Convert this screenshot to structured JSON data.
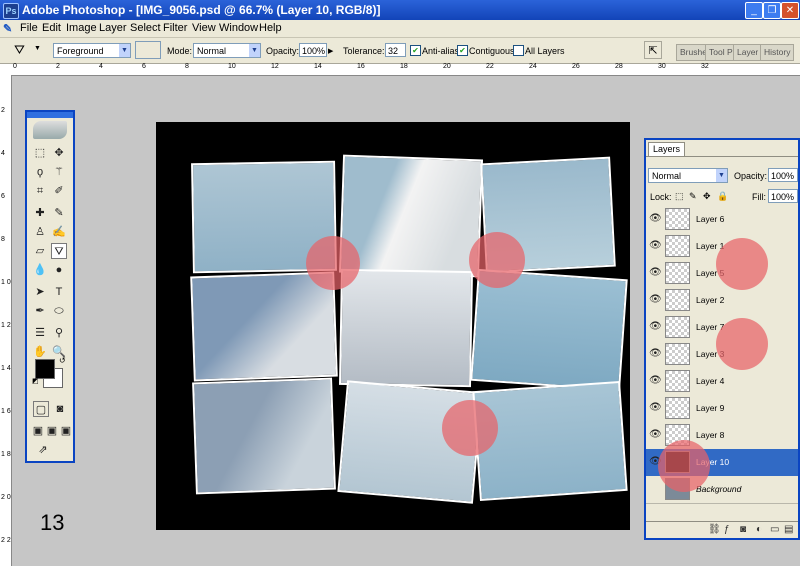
{
  "window": {
    "title": "Adobe Photoshop - [IMG_9056.psd @ 66.7% (Layer 10, RGB/8)]",
    "minimize": "_",
    "restore": "❐",
    "close": "✕"
  },
  "menu": [
    "File",
    "Edit",
    "Image",
    "Layer",
    "Select",
    "Filter",
    "View",
    "Window",
    "Help"
  ],
  "options": {
    "fill_source": "Foreground",
    "mode_label": "Mode:",
    "mode_value": "Normal",
    "opacity_label": "Opacity:",
    "opacity_value": "100%",
    "tolerance_label": "Tolerance:",
    "tolerance_value": "32",
    "anti_alias_label": "Anti-alias",
    "contiguous_label": "Contiguous",
    "all_layers_label": "All Layers",
    "anti_alias_checked": true,
    "contiguous_checked": true,
    "all_layers_checked": false
  },
  "palette_well": [
    "Brushe",
    "Tool P",
    "Layer",
    "History"
  ],
  "ruler_numbers": [
    "0",
    "2",
    "4",
    "6",
    "8",
    "10",
    "12",
    "14",
    "16",
    "18",
    "20",
    "22",
    "24",
    "26",
    "28",
    "30",
    "32"
  ],
  "vruler_numbers": [
    "2",
    "4",
    "6",
    "8",
    "1 0",
    "1 2",
    "1 4",
    "1 6",
    "1 8",
    "2 0",
    "2 2"
  ],
  "step_number": "13",
  "tools": [
    "marquee-icon",
    "move-icon",
    "lasso-icon",
    "magic-wand-icon",
    "crop-icon",
    "slice-icon",
    "healing-brush-icon",
    "brush-icon",
    "clone-stamp-icon",
    "history-brush-icon",
    "eraser-icon",
    "paint-bucket-icon",
    "blur-icon",
    "dodge-icon",
    "path-selection-icon",
    "type-icon",
    "pen-icon",
    "shape-icon",
    "notes-icon",
    "eyedropper-icon",
    "hand-icon",
    "zoom-icon"
  ],
  "layers_panel": {
    "tab": "Layers",
    "blend_mode": "Normal",
    "opacity_label": "Opacity:",
    "opacity_value": "100%",
    "lock_label": "Lock:",
    "fill_label": "Fill:",
    "fill_value": "100%",
    "layers": [
      {
        "name": "Layer 6",
        "active": false
      },
      {
        "name": "Layer 1",
        "active": false
      },
      {
        "name": "Layer 5",
        "active": false
      },
      {
        "name": "Layer 2",
        "active": false
      },
      {
        "name": "Layer 7",
        "active": false
      },
      {
        "name": "Layer 3",
        "active": false
      },
      {
        "name": "Layer 4",
        "active": false
      },
      {
        "name": "Layer 9",
        "active": false
      },
      {
        "name": "Layer 8",
        "active": false
      },
      {
        "name": "Layer 10",
        "active": true
      },
      {
        "name": "Background",
        "active": false
      }
    ]
  },
  "colors": {
    "titlebar": "#1548c4",
    "highlight_circle": "#e86268",
    "active_layer": "#316ac5",
    "canvas": "#000000"
  }
}
